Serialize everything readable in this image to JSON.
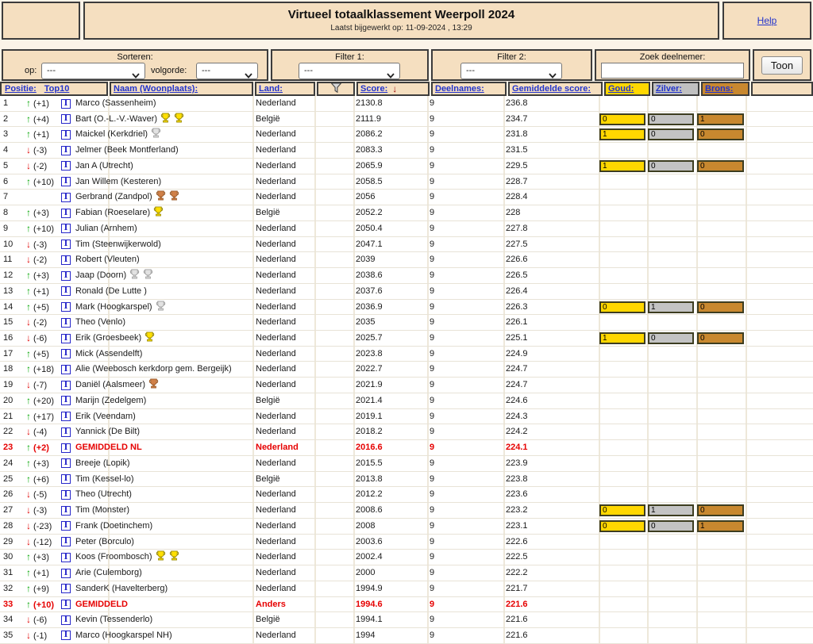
{
  "header": {
    "title": "Virtueel totaalklassement Weerpoll 2024",
    "subtitle": "Laatst bijgewerkt op: 11-09-2024 , 13:29",
    "help_label": "Help"
  },
  "filters": {
    "sorteren_label": "Sorteren:",
    "op_label": "op:",
    "op_value": "---",
    "volgorde_label": "volgorde:",
    "volgorde_value": "---",
    "filter1_label": "Filter 1:",
    "filter1_value": "---",
    "filter2_label": "Filter 2:",
    "filter2_value": "---",
    "zoek_label": "Zoek deelnemer:",
    "zoek_value": "",
    "toon_label": "Toon"
  },
  "columns": {
    "positie": "Positie:",
    "top10": "Top10",
    "naam": "Naam (Woonplaats):",
    "land": "Land:",
    "funnel_icon": "filter-funnel-icon",
    "score": "Score:",
    "score_sort_arrow": "↓",
    "deelnames": "Deelnames:",
    "gemiddelde": "Gemiddelde score:",
    "goud": "Goud:",
    "zilver": "Zilver:",
    "brons": "Brons:"
  },
  "colors": {
    "gold": "#ffd700",
    "silver": "#c0c0c0",
    "bronze": "#c8882f",
    "highlight_red": "#e60000",
    "arrow_up_green": "#00a500",
    "arrow_down_red": "#e00000",
    "panel_wheat": "#f5dfc0",
    "link_blue": "#2233cc",
    "trophy": {
      "gold": {
        "fill": "#ffe000",
        "stroke": "#9a8a00"
      },
      "silver": {
        "fill": "#e2e2e2",
        "stroke": "#9f9f9f"
      },
      "bronze": {
        "fill": "#d08048",
        "stroke": "#9a5a28"
      }
    }
  },
  "table": {
    "rows": [
      {
        "pos": "1",
        "dir": "up",
        "delta": "(+1)",
        "name": "Marco (Sassenheim)",
        "trophies": [],
        "land": "Nederland",
        "score": "2130.8",
        "deel": "9",
        "avg": "236.8",
        "medals": null,
        "hl": false
      },
      {
        "pos": "2",
        "dir": "up",
        "delta": "(+4)",
        "name": "Bart (O.-L.-V.-Waver)",
        "trophies": [
          "gold",
          "gold"
        ],
        "land": "België",
        "score": "2111.9",
        "deel": "9",
        "avg": "234.7",
        "medals": {
          "goud": "0",
          "zilver": "0",
          "brons": "1"
        },
        "hl": false
      },
      {
        "pos": "3",
        "dir": "up",
        "delta": "(+1)",
        "name": "Maickel (Kerkdriel)",
        "trophies": [
          "silver"
        ],
        "land": "Nederland",
        "score": "2086.2",
        "deel": "9",
        "avg": "231.8",
        "medals": {
          "goud": "1",
          "zilver": "0",
          "brons": "0"
        },
        "hl": false
      },
      {
        "pos": "4",
        "dir": "down",
        "delta": "(-3)",
        "name": "Jelmer (Beek Montferland)",
        "trophies": [],
        "land": "Nederland",
        "score": "2083.3",
        "deel": "9",
        "avg": "231.5",
        "medals": null,
        "hl": false
      },
      {
        "pos": "5",
        "dir": "down",
        "delta": "(-2)",
        "name": "Jan A (Utrecht)",
        "trophies": [],
        "land": "Nederland",
        "score": "2065.9",
        "deel": "9",
        "avg": "229.5",
        "medals": {
          "goud": "1",
          "zilver": "0",
          "brons": "0"
        },
        "hl": false
      },
      {
        "pos": "6",
        "dir": "up",
        "delta": "(+10)",
        "name": "Jan Willem (Kesteren)",
        "trophies": [],
        "land": "Nederland",
        "score": "2058.5",
        "deel": "9",
        "avg": "228.7",
        "medals": null,
        "hl": false
      },
      {
        "pos": "7",
        "dir": "",
        "delta": "",
        "name": "Gerbrand (Zandpol)",
        "trophies": [
          "bronze",
          "bronze"
        ],
        "land": "Nederland",
        "score": "2056",
        "deel": "9",
        "avg": "228.4",
        "medals": null,
        "hl": false
      },
      {
        "pos": "8",
        "dir": "up",
        "delta": "(+3)",
        "name": "Fabian (Roeselare)",
        "trophies": [
          "gold"
        ],
        "land": "België",
        "score": "2052.2",
        "deel": "9",
        "avg": "228",
        "medals": null,
        "hl": false
      },
      {
        "pos": "9",
        "dir": "up",
        "delta": "(+10)",
        "name": "Julian (Arnhem)",
        "trophies": [],
        "land": "Nederland",
        "score": "2050.4",
        "deel": "9",
        "avg": "227.8",
        "medals": null,
        "hl": false
      },
      {
        "pos": "10",
        "dir": "down",
        "delta": "(-3)",
        "name": "Tim (Steenwijkerwold)",
        "trophies": [],
        "land": "Nederland",
        "score": "2047.1",
        "deel": "9",
        "avg": "227.5",
        "medals": null,
        "hl": false
      },
      {
        "pos": "11",
        "dir": "down",
        "delta": "(-2)",
        "name": "Robert (Vleuten)",
        "trophies": [],
        "land": "Nederland",
        "score": "2039",
        "deel": "9",
        "avg": "226.6",
        "medals": null,
        "hl": false
      },
      {
        "pos": "12",
        "dir": "up",
        "delta": "(+3)",
        "name": "Jaap (Doorn)",
        "trophies": [
          "silver",
          "silver"
        ],
        "land": "Nederland",
        "score": "2038.6",
        "deel": "9",
        "avg": "226.5",
        "medals": null,
        "hl": false
      },
      {
        "pos": "13",
        "dir": "up",
        "delta": "(+1)",
        "name": "Ronald (De Lutte )",
        "trophies": [],
        "land": "Nederland",
        "score": "2037.6",
        "deel": "9",
        "avg": "226.4",
        "medals": null,
        "hl": false
      },
      {
        "pos": "14",
        "dir": "up",
        "delta": "(+5)",
        "name": "Mark (Hoogkarspel)",
        "trophies": [
          "silver"
        ],
        "land": "Nederland",
        "score": "2036.9",
        "deel": "9",
        "avg": "226.3",
        "medals": {
          "goud": "0",
          "zilver": "1",
          "brons": "0"
        },
        "hl": false
      },
      {
        "pos": "15",
        "dir": "down",
        "delta": "(-2)",
        "name": "Theo (Venlo)",
        "trophies": [],
        "land": "Nederland",
        "score": "2035",
        "deel": "9",
        "avg": "226.1",
        "medals": null,
        "hl": false
      },
      {
        "pos": "16",
        "dir": "down",
        "delta": "(-6)",
        "name": "Erik (Groesbeek)",
        "trophies": [
          "gold"
        ],
        "land": "Nederland",
        "score": "2025.7",
        "deel": "9",
        "avg": "225.1",
        "medals": {
          "goud": "1",
          "zilver": "0",
          "brons": "0"
        },
        "hl": false
      },
      {
        "pos": "17",
        "dir": "up",
        "delta": "(+5)",
        "name": "Mick (Assendelft)",
        "trophies": [],
        "land": "Nederland",
        "score": "2023.8",
        "deel": "9",
        "avg": "224.9",
        "medals": null,
        "hl": false
      },
      {
        "pos": "18",
        "dir": "up",
        "delta": "(+18)",
        "name": "Alie (Weebosch kerkdorp gem. Bergeijk)",
        "trophies": [],
        "land": "Nederland",
        "score": "2022.7",
        "deel": "9",
        "avg": "224.7",
        "medals": null,
        "hl": false
      },
      {
        "pos": "19",
        "dir": "down",
        "delta": "(-7)",
        "name": "Daniël (Aalsmeer)",
        "trophies": [
          "bronze"
        ],
        "land": "Nederland",
        "score": "2021.9",
        "deel": "9",
        "avg": "224.7",
        "medals": null,
        "hl": false
      },
      {
        "pos": "20",
        "dir": "up",
        "delta": "(+20)",
        "name": "Marijn (Zedelgem)",
        "trophies": [],
        "land": "België",
        "score": "2021.4",
        "deel": "9",
        "avg": "224.6",
        "medals": null,
        "hl": false
      },
      {
        "pos": "21",
        "dir": "up",
        "delta": "(+17)",
        "name": "Erik (Veendam)",
        "trophies": [],
        "land": "Nederland",
        "score": "2019.1",
        "deel": "9",
        "avg": "224.3",
        "medals": null,
        "hl": false
      },
      {
        "pos": "22",
        "dir": "down",
        "delta": "(-4)",
        "name": "Yannick (De Bilt)",
        "trophies": [],
        "land": "Nederland",
        "score": "2018.2",
        "deel": "9",
        "avg": "224.2",
        "medals": null,
        "hl": false
      },
      {
        "pos": "23",
        "dir": "up",
        "delta": "(+2)",
        "name": "GEMIDDELD NL",
        "trophies": [],
        "land": "Nederland",
        "score": "2016.6",
        "deel": "9",
        "avg": "224.1",
        "medals": null,
        "hl": true
      },
      {
        "pos": "24",
        "dir": "up",
        "delta": "(+3)",
        "name": "Breeje (Lopik)",
        "trophies": [],
        "land": "Nederland",
        "score": "2015.5",
        "deel": "9",
        "avg": "223.9",
        "medals": null,
        "hl": false
      },
      {
        "pos": "25",
        "dir": "up",
        "delta": "(+6)",
        "name": "Tim (Kessel-lo)",
        "trophies": [],
        "land": "België",
        "score": "2013.8",
        "deel": "9",
        "avg": "223.8",
        "medals": null,
        "hl": false
      },
      {
        "pos": "26",
        "dir": "down",
        "delta": "(-5)",
        "name": "Theo (Utrecht)",
        "trophies": [],
        "land": "Nederland",
        "score": "2012.2",
        "deel": "9",
        "avg": "223.6",
        "medals": null,
        "hl": false
      },
      {
        "pos": "27",
        "dir": "down",
        "delta": "(-3)",
        "name": "Tim (Monster)",
        "trophies": [],
        "land": "Nederland",
        "score": "2008.6",
        "deel": "9",
        "avg": "223.2",
        "medals": {
          "goud": "0",
          "zilver": "1",
          "brons": "0"
        },
        "hl": false
      },
      {
        "pos": "28",
        "dir": "down",
        "delta": "(-23)",
        "name": "Frank (Doetinchem)",
        "trophies": [],
        "land": "Nederland",
        "score": "2008",
        "deel": "9",
        "avg": "223.1",
        "medals": {
          "goud": "0",
          "zilver": "0",
          "brons": "1"
        },
        "hl": false
      },
      {
        "pos": "29",
        "dir": "down",
        "delta": "(-12)",
        "name": "Peter (Borculo)",
        "trophies": [],
        "land": "Nederland",
        "score": "2003.6",
        "deel": "9",
        "avg": "222.6",
        "medals": null,
        "hl": false
      },
      {
        "pos": "30",
        "dir": "up",
        "delta": "(+3)",
        "name": "Koos (Froombosch)",
        "trophies": [
          "gold",
          "gold"
        ],
        "land": "Nederland",
        "score": "2002.4",
        "deel": "9",
        "avg": "222.5",
        "medals": null,
        "hl": false
      },
      {
        "pos": "31",
        "dir": "up",
        "delta": "(+1)",
        "name": "Arie (Culemborg)",
        "trophies": [],
        "land": "Nederland",
        "score": "2000",
        "deel": "9",
        "avg": "222.2",
        "medals": null,
        "hl": false
      },
      {
        "pos": "32",
        "dir": "up",
        "delta": "(+9)",
        "name": "SanderK (Havelterberg)",
        "trophies": [],
        "land": "Nederland",
        "score": "1994.9",
        "deel": "9",
        "avg": "221.7",
        "medals": null,
        "hl": false
      },
      {
        "pos": "33",
        "dir": "up",
        "delta": "(+10)",
        "name": "GEMIDDELD",
        "trophies": [],
        "land": "Anders",
        "score": "1994.6",
        "deel": "9",
        "avg": "221.6",
        "medals": null,
        "hl": true
      },
      {
        "pos": "34",
        "dir": "down",
        "delta": "(-6)",
        "name": "Kevin (Tessenderlo)",
        "trophies": [],
        "land": "België",
        "score": "1994.1",
        "deel": "9",
        "avg": "221.6",
        "medals": null,
        "hl": false
      },
      {
        "pos": "35",
        "dir": "down",
        "delta": "(-1)",
        "name": "Marco (Hoogkarspel NH)",
        "trophies": [],
        "land": "Nederland",
        "score": "1994",
        "deel": "9",
        "avg": "221.6",
        "medals": null,
        "hl": false
      }
    ]
  }
}
